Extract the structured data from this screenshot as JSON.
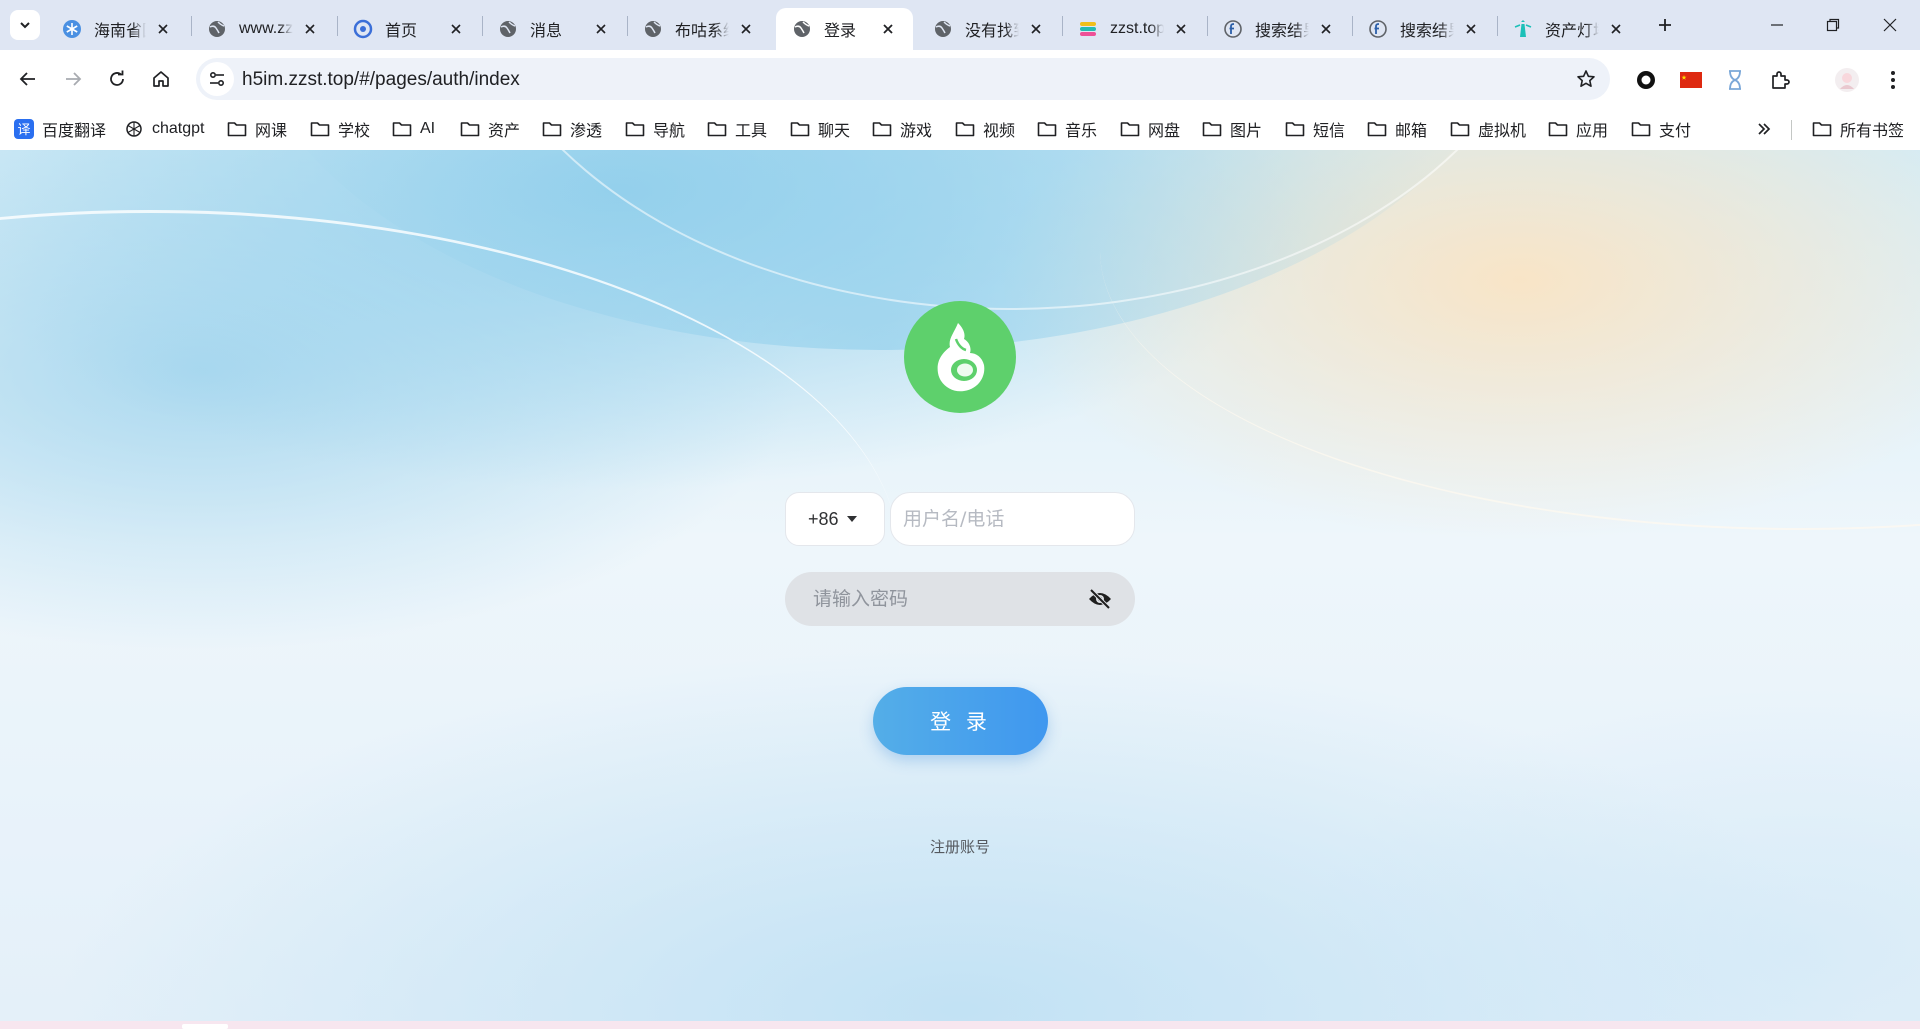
{
  "browser": {
    "tabs": [
      {
        "title": "海南省国",
        "icon": "snowflake-icon",
        "active": false
      },
      {
        "title": "www.zz",
        "icon": "globe-icon",
        "active": false
      },
      {
        "title": "首页",
        "icon": "swirl-logo-icon",
        "active": false
      },
      {
        "title": "消息",
        "icon": "globe-icon",
        "active": false
      },
      {
        "title": "布咕系统",
        "icon": "globe-icon",
        "active": false
      },
      {
        "title": "登录",
        "icon": "globe-icon",
        "active": true
      },
      {
        "title": "没有找到",
        "icon": "globe-icon",
        "active": false
      },
      {
        "title": "zzst.top",
        "icon": "elastic-logo-icon",
        "active": false
      },
      {
        "title": "搜索结果",
        "icon": "f-logo-icon",
        "active": false
      },
      {
        "title": "搜索结果",
        "icon": "f-logo-icon",
        "active": false
      },
      {
        "title": "资产灯塔",
        "icon": "lighthouse-icon",
        "active": false
      }
    ],
    "address_bar": {
      "url": "h5im.zzst.top/#/pages/auth/index"
    },
    "bookmarks": [
      {
        "label": "百度翻译",
        "icon": "baidu-translate-icon"
      },
      {
        "label": "chatgpt",
        "icon": "openai-icon"
      },
      {
        "label": "网课",
        "icon": "folder-icon"
      },
      {
        "label": "学校",
        "icon": "folder-icon"
      },
      {
        "label": "AI",
        "icon": "folder-icon"
      },
      {
        "label": "资产",
        "icon": "folder-icon"
      },
      {
        "label": "渗透",
        "icon": "folder-icon"
      },
      {
        "label": "导航",
        "icon": "folder-icon"
      },
      {
        "label": "工具",
        "icon": "folder-icon"
      },
      {
        "label": "聊天",
        "icon": "folder-icon"
      },
      {
        "label": "游戏",
        "icon": "folder-icon"
      },
      {
        "label": "视频",
        "icon": "folder-icon"
      },
      {
        "label": "音乐",
        "icon": "folder-icon"
      },
      {
        "label": "网盘",
        "icon": "folder-icon"
      },
      {
        "label": "图片",
        "icon": "folder-icon"
      },
      {
        "label": "短信",
        "icon": "folder-icon"
      },
      {
        "label": "邮箱",
        "icon": "folder-icon"
      },
      {
        "label": "虚拟机",
        "icon": "folder-icon"
      },
      {
        "label": "应用",
        "icon": "folder-icon"
      },
      {
        "label": "支付",
        "icon": "folder-icon"
      }
    ],
    "all_bookmarks_label": "所有书签"
  },
  "login": {
    "country_code": "+86",
    "username_placeholder": "用户名/电话",
    "password_placeholder": "请输入密码",
    "login_button_label": "登 录",
    "register_link_label": "注册账号"
  },
  "colors": {
    "logo_green": "#5ed06c",
    "button_blue": "#4ba3ec",
    "tabstrip_bg": "#dfe6f3"
  }
}
